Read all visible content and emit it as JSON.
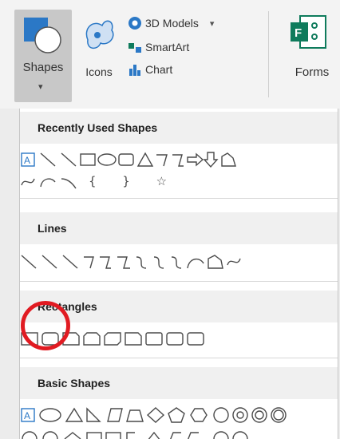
{
  "ribbon": {
    "shapes_label": "Shapes",
    "icons_label": "Icons",
    "models_label": "3D Models",
    "smartart_label": "SmartArt",
    "chart_label": "Chart",
    "forms_label": "Forms"
  },
  "panel": {
    "sections": [
      {
        "title": "Recently Used Shapes"
      },
      {
        "title": "Lines"
      },
      {
        "title": "Rectangles"
      },
      {
        "title": "Basic Shapes"
      }
    ],
    "recent_row2_text": "{ } ☆"
  },
  "colors": {
    "highlight": "#e11b22",
    "accent_blue": "#2b78c6",
    "forms_green": "#0f7b5c"
  }
}
